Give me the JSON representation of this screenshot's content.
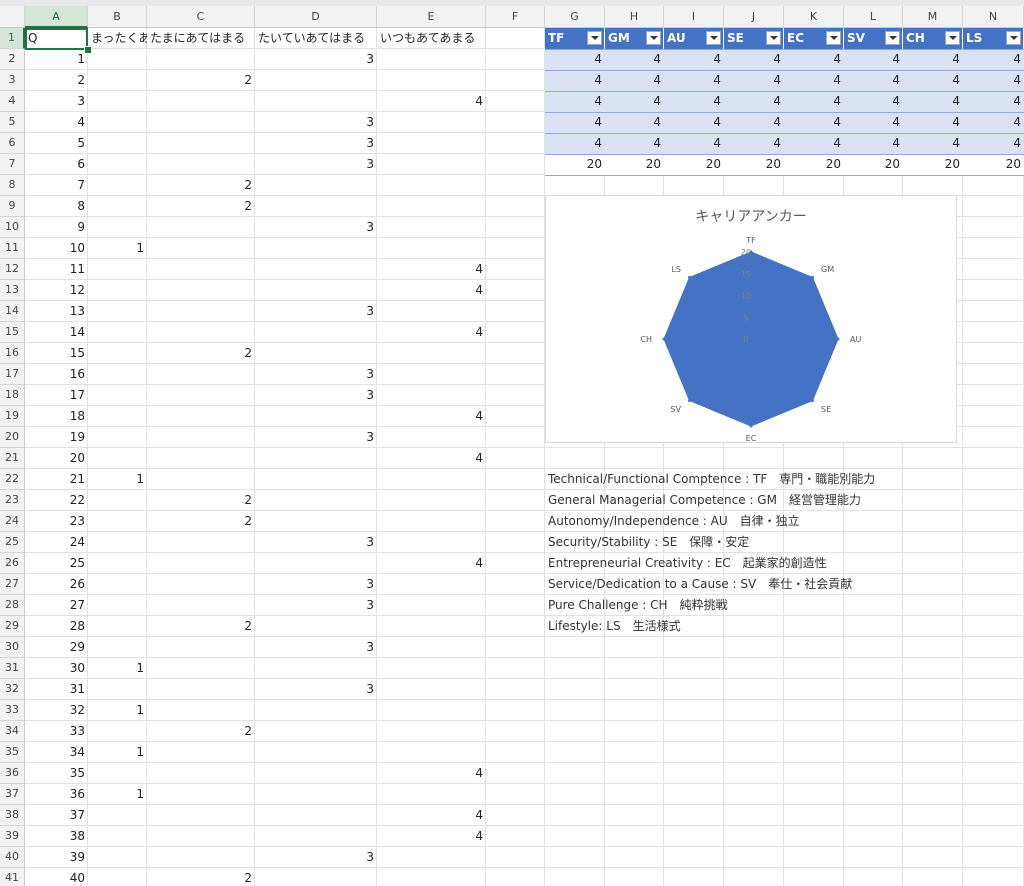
{
  "columns": [
    "A",
    "B",
    "C",
    "D",
    "E",
    "F",
    "G",
    "H",
    "I",
    "J",
    "K",
    "L",
    "M",
    "N"
  ],
  "header_row": {
    "A": "Q",
    "B": "まったくあてはまらない",
    "C": "たまにあてはまる",
    "D": "たいていあてはまる",
    "E": "いつもあてあまる"
  },
  "rows": [
    {
      "q": "1",
      "col": "D",
      "v": "3"
    },
    {
      "q": "2",
      "col": "C",
      "v": "2"
    },
    {
      "q": "3",
      "col": "E",
      "v": "4"
    },
    {
      "q": "4",
      "col": "D",
      "v": "3"
    },
    {
      "q": "5",
      "col": "D",
      "v": "3"
    },
    {
      "q": "6",
      "col": "D",
      "v": "3"
    },
    {
      "q": "7",
      "col": "C",
      "v": "2"
    },
    {
      "q": "8",
      "col": "C",
      "v": "2"
    },
    {
      "q": "9",
      "col": "D",
      "v": "3"
    },
    {
      "q": "10",
      "col": "B",
      "v": "1"
    },
    {
      "q": "11",
      "col": "E",
      "v": "4"
    },
    {
      "q": "12",
      "col": "E",
      "v": "4"
    },
    {
      "q": "13",
      "col": "D",
      "v": "3"
    },
    {
      "q": "14",
      "col": "E",
      "v": "4"
    },
    {
      "q": "15",
      "col": "C",
      "v": "2"
    },
    {
      "q": "16",
      "col": "D",
      "v": "3"
    },
    {
      "q": "17",
      "col": "D",
      "v": "3"
    },
    {
      "q": "18",
      "col": "E",
      "v": "4"
    },
    {
      "q": "19",
      "col": "D",
      "v": "3"
    },
    {
      "q": "20",
      "col": "E",
      "v": "4"
    },
    {
      "q": "21",
      "col": "B",
      "v": "1"
    },
    {
      "q": "22",
      "col": "C",
      "v": "2"
    },
    {
      "q": "23",
      "col": "C",
      "v": "2"
    },
    {
      "q": "24",
      "col": "D",
      "v": "3"
    },
    {
      "q": "25",
      "col": "E",
      "v": "4"
    },
    {
      "q": "26",
      "col": "D",
      "v": "3"
    },
    {
      "q": "27",
      "col": "D",
      "v": "3"
    },
    {
      "q": "28",
      "col": "C",
      "v": "2"
    },
    {
      "q": "29",
      "col": "D",
      "v": "3"
    },
    {
      "q": "30",
      "col": "B",
      "v": "1"
    },
    {
      "q": "31",
      "col": "D",
      "v": "3"
    },
    {
      "q": "32",
      "col": "B",
      "v": "1"
    },
    {
      "q": "33",
      "col": "C",
      "v": "2"
    },
    {
      "q": "34",
      "col": "B",
      "v": "1"
    },
    {
      "q": "35",
      "col": "E",
      "v": "4"
    },
    {
      "q": "36",
      "col": "B",
      "v": "1"
    },
    {
      "q": "37",
      "col": "E",
      "v": "4"
    },
    {
      "q": "38",
      "col": "E",
      "v": "4"
    },
    {
      "q": "39",
      "col": "D",
      "v": "3"
    },
    {
      "q": "40",
      "col": "C",
      "v": "2"
    }
  ],
  "table": {
    "headers": [
      "TF",
      "GM",
      "AU",
      "SE",
      "EC",
      "SV",
      "CH",
      "LS"
    ],
    "rows": [
      [
        "4",
        "4",
        "4",
        "4",
        "4",
        "4",
        "4",
        "4"
      ],
      [
        "4",
        "4",
        "4",
        "4",
        "4",
        "4",
        "4",
        "4"
      ],
      [
        "4",
        "4",
        "4",
        "4",
        "4",
        "4",
        "4",
        "4"
      ],
      [
        "4",
        "4",
        "4",
        "4",
        "4",
        "4",
        "4",
        "4"
      ],
      [
        "4",
        "4",
        "4",
        "4",
        "4",
        "4",
        "4",
        "4"
      ],
      [
        "20",
        "20",
        "20",
        "20",
        "20",
        "20",
        "20",
        "20"
      ]
    ],
    "header_color": "#4472c4",
    "band_color": "#d9e1f2"
  },
  "chart_data": {
    "type": "radar",
    "title": "キャリアアンカー",
    "categories": [
      "TF",
      "GM",
      "AU",
      "SE",
      "EC",
      "SV",
      "CH",
      "LS"
    ],
    "values": [
      20,
      20,
      20,
      20,
      20,
      20,
      20,
      20
    ],
    "rlim": [
      0,
      20
    ],
    "ticks": [
      "0",
      "5",
      "10",
      "15",
      "20"
    ],
    "fill_color": "#4472c4"
  },
  "legend_lines": [
    "Technical/Functional Comptence : TF　専門・職能別能力",
    "General Managerial Competence : GM　経営管理能力",
    "Autonomy/Independence : AU　自律・独立",
    "Security/Stability : SE　保障・安定",
    "Entrepreneurial Creativity : EC　起業家的創造性",
    "Service/Dedication to a Cause : SV　奉仕・社会貢献",
    "Pure Challenge : CH　純粋挑戦",
    "Lifestyle: LS　生活様式"
  ],
  "colors": {
    "accent": "#217346",
    "grid": "#e1e1e1"
  }
}
